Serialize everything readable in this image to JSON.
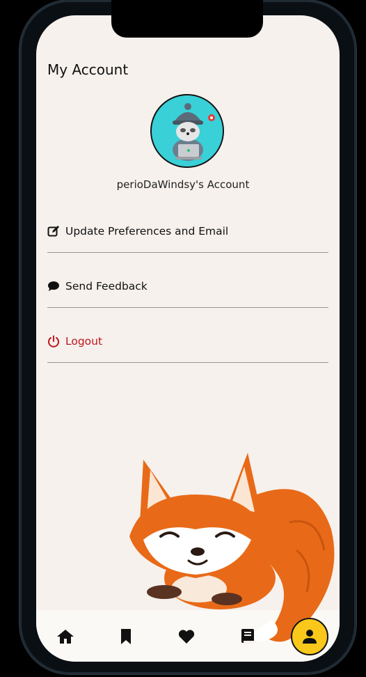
{
  "page": {
    "title": "My Account"
  },
  "profile": {
    "account_name": "perioDaWindsy's Account"
  },
  "menu": {
    "items": [
      {
        "label": "Update Preferences and Email",
        "icon": "edit-icon"
      },
      {
        "label": "Send Feedback",
        "icon": "comment-icon"
      },
      {
        "label": "Logout",
        "icon": "power-icon"
      }
    ]
  },
  "colors": {
    "background": "#f6f1ed",
    "avatar_bg": "#39d0d8",
    "logout": "#c0151c",
    "active_nav": "#f9c81a"
  },
  "nav": {
    "items": [
      "home-icon",
      "bookmark-icon",
      "heart-icon",
      "book-icon",
      "user-icon"
    ],
    "active": "user-icon"
  }
}
